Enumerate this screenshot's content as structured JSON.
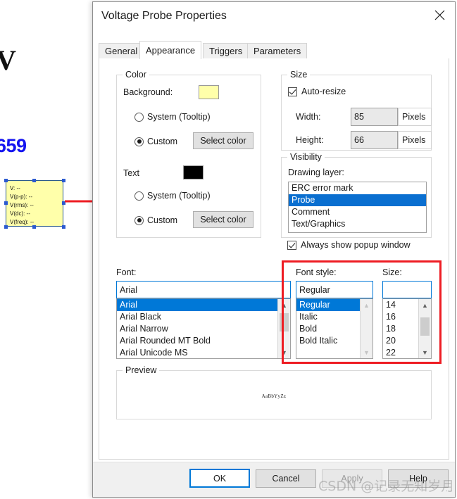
{
  "colors": {
    "accent": "#0078d7",
    "annotation_red": "#ee1c23",
    "probe_background": "#ffffaa",
    "probe_text": "#000000",
    "net_label": "#1414f0",
    "dialog_background": "#ffffff"
  },
  "schematic": {
    "cut_glyph": "V",
    "net_label": "659",
    "probe_tooltip": {
      "lines": [
        "V:  --",
        "V(p-p):  --",
        "V(rms):  --",
        "V(dc):  --",
        "V(freq):  --"
      ]
    }
  },
  "dialog": {
    "title": "Voltage Probe Properties",
    "close_icon": "close-icon",
    "tabs": [
      {
        "label": "General",
        "active": false
      },
      {
        "label": "Appearance",
        "active": true
      },
      {
        "label": "Triggers",
        "active": false
      },
      {
        "label": "Parameters",
        "active": false
      }
    ],
    "color_group": {
      "legend": "Color",
      "background_label": "Background:",
      "background_swatch": "#ffffaa",
      "background_system_radio": "System (Tooltip)",
      "background_custom_radio": "Custom",
      "background_select_button": "Select color",
      "text_label": "Text",
      "text_swatch": "#000000",
      "text_system_radio": "System (Tooltip)",
      "text_custom_radio": "Custom",
      "text_select_button": "Select color"
    },
    "size_group": {
      "legend": "Size",
      "auto_resize_label": "Auto-resize",
      "auto_resize_checked": true,
      "width_label": "Width:",
      "width_value": "85",
      "width_units": "Pixels",
      "height_label": "Height:",
      "height_value": "66",
      "height_units": "Pixels"
    },
    "visibility_group": {
      "legend": "Visibility",
      "drawing_layer_label": "Drawing layer:",
      "layers": [
        {
          "label": "ERC error mark",
          "selected": false
        },
        {
          "label": "Probe",
          "selected": true
        },
        {
          "label": "Comment",
          "selected": false
        },
        {
          "label": "Text/Graphics",
          "selected": false
        }
      ],
      "always_show_label": "Always show popup window",
      "always_show_checked": true
    },
    "font_section": {
      "font_label": "Font:",
      "font_value": "Arial",
      "font_options": [
        {
          "label": "Arial",
          "selected": true
        },
        {
          "label": "Arial Black",
          "selected": false
        },
        {
          "label": "Arial Narrow",
          "selected": false
        },
        {
          "label": "Arial Rounded MT Bold",
          "selected": false
        },
        {
          "label": "Arial Unicode MS",
          "selected": false
        }
      ],
      "style_label": "Font style:",
      "style_value": "Regular",
      "style_options": [
        {
          "label": "Regular",
          "selected": true
        },
        {
          "label": "Italic",
          "selected": false
        },
        {
          "label": "Bold",
          "selected": false
        },
        {
          "label": "Bold Italic",
          "selected": false
        }
      ],
      "size_label": "Size:",
      "size_value": "",
      "size_placeholder": "",
      "size_options": [
        {
          "label": "14",
          "selected": false
        },
        {
          "label": "16",
          "selected": false
        },
        {
          "label": "18",
          "selected": false
        },
        {
          "label": "20",
          "selected": false
        },
        {
          "label": "22",
          "selected": false
        }
      ]
    },
    "preview_group": {
      "legend": "Preview",
      "sample_text": "AaBbYyZz"
    },
    "footer": {
      "ok_label": "OK",
      "cancel_label": "Cancel",
      "apply_label": "Apply",
      "apply_disabled": true,
      "help_label": "Help"
    }
  },
  "watermark": "CSDN @记录无知岁月"
}
